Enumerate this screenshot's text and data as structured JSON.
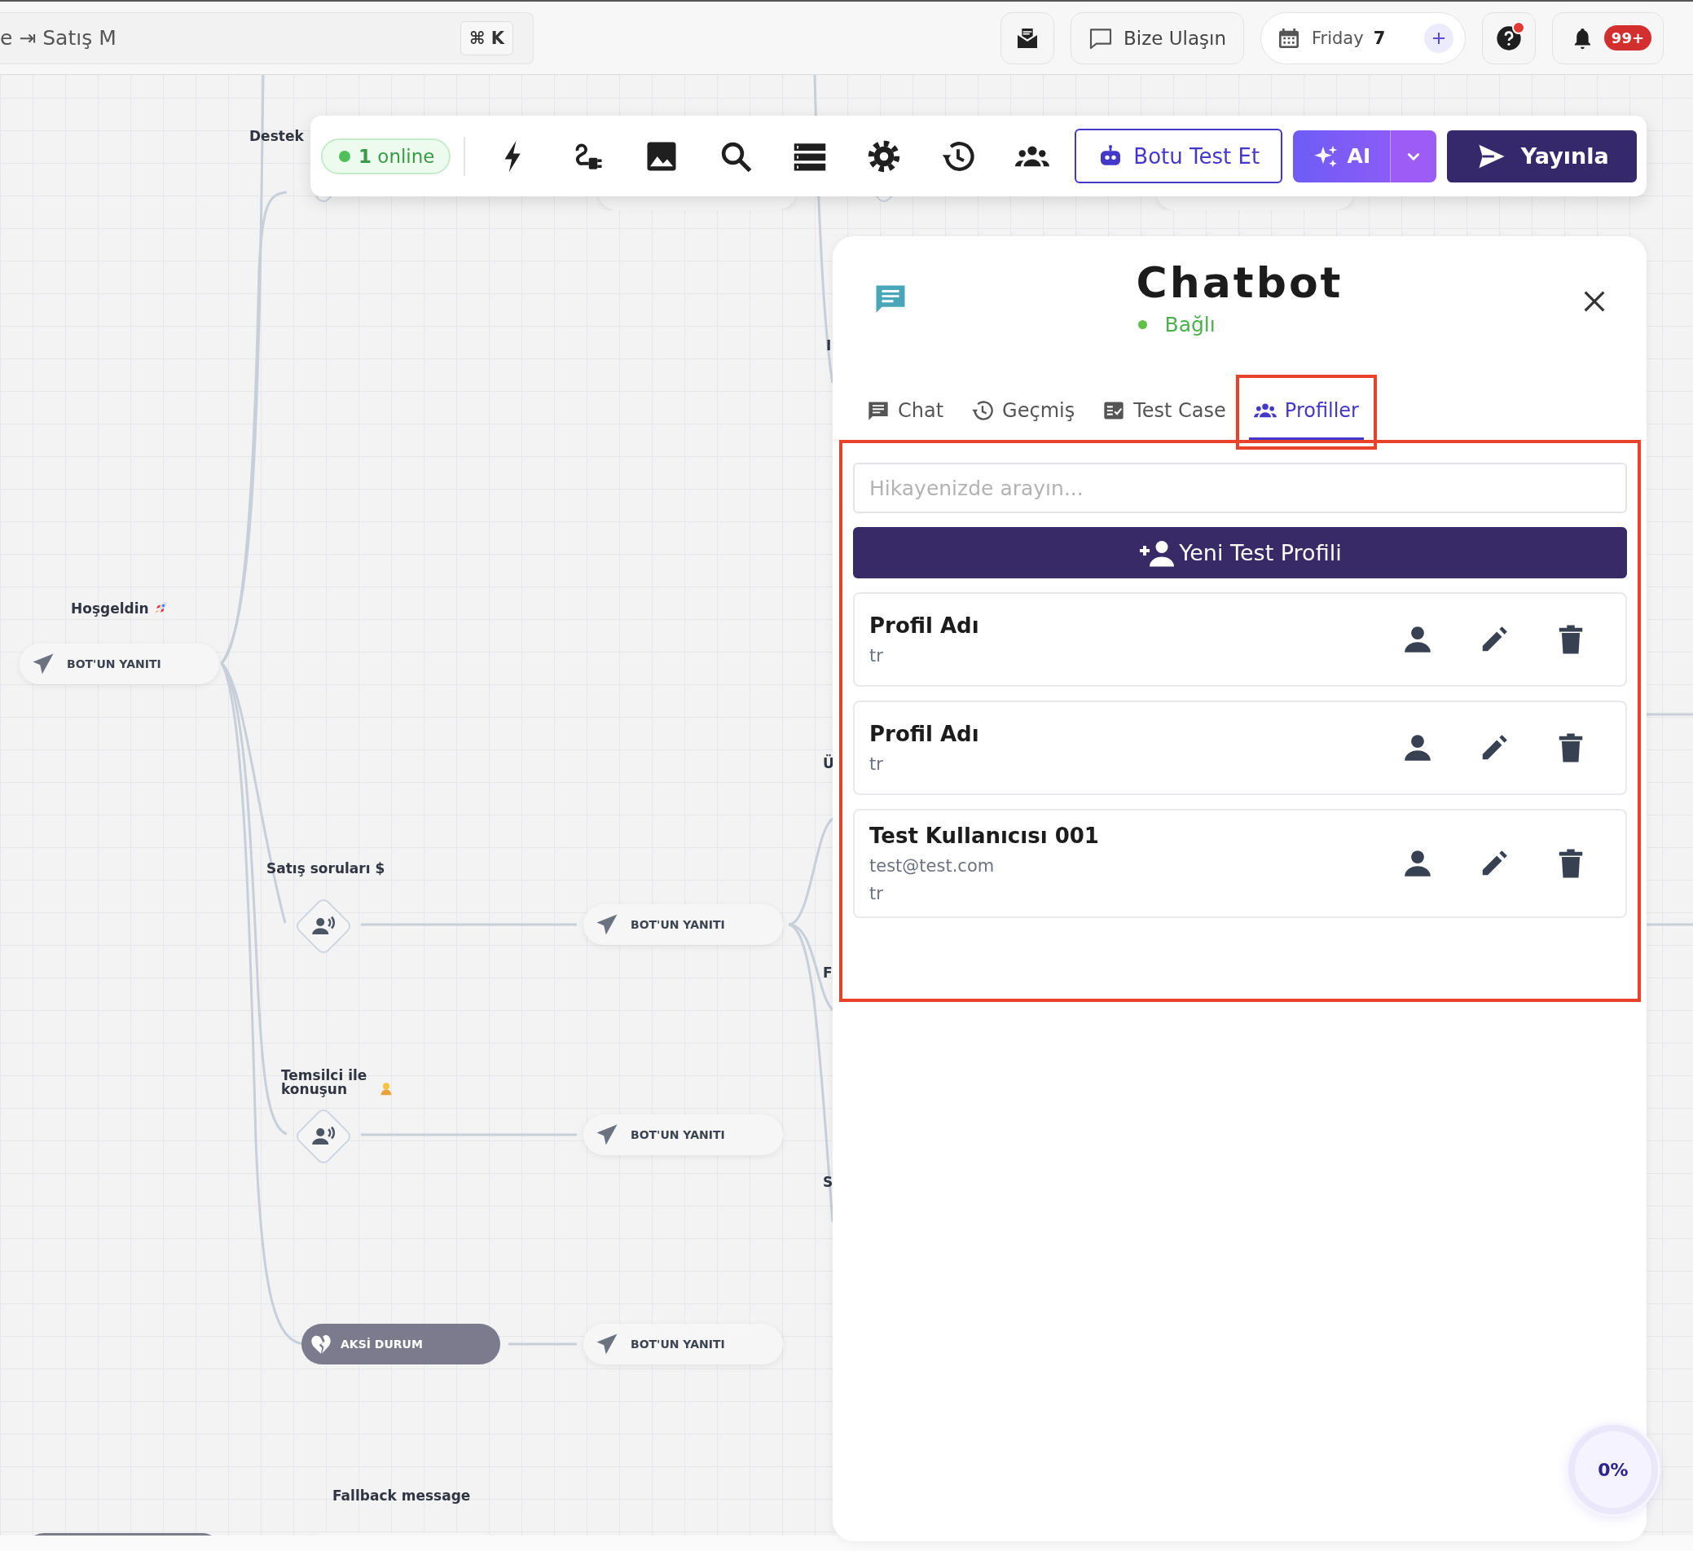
{
  "top_bar": {
    "breadcrumb": "e ⇥ Satış M",
    "shortcut": "⌘ K",
    "actions": [
      {
        "kind": "inbox"
      },
      {
        "kind": "contact",
        "label": "Bize Ulaşın"
      },
      {
        "kind": "date",
        "label": "Friday",
        "value": "7"
      },
      {
        "kind": "help",
        "alert": true
      },
      {
        "kind": "notifications",
        "badge": "99+"
      }
    ]
  },
  "toolbar": {
    "online": "**1** online",
    "tools": [
      {
        "kind": "bolt"
      },
      {
        "kind": "plug"
      },
      {
        "kind": "image"
      },
      {
        "kind": "search"
      },
      {
        "kind": "list"
      },
      {
        "kind": "settings"
      },
      {
        "kind": "history"
      },
      {
        "kind": "users"
      }
    ],
    "test_button": "Botu Test Et",
    "ai_button": "AI",
    "publish_button": "Yayınla"
  },
  "canvas": {
    "labels": [
      "Destek",
      "I",
      "Hoşgeldin",
      "Ü",
      "Satış soruları $",
      "F",
      "Temsilci ile konuşun",
      "S",
      "Fallback message"
    ],
    "nodes": [
      {
        "kind": "intent"
      },
      {
        "kind": "reply"
      },
      {
        "kind": "intent"
      },
      {
        "kind": "reply"
      },
      {
        "kind": "reply",
        "label": "BOT'UN YANITI"
      },
      {
        "kind": "intent"
      },
      {
        "kind": "reply",
        "label": "BOT'UN YANITI"
      },
      {
        "kind": "intent"
      },
      {
        "kind": "reply",
        "label": "BOT'UN YANITI"
      },
      {
        "kind": "fallback",
        "label": "AKSİ DURUM"
      },
      {
        "kind": "reply",
        "label": "BOT'UN YANITI"
      },
      {
        "kind": "fallback"
      },
      {
        "kind": "reply"
      }
    ]
  },
  "panel": {
    "title": "Chatbot",
    "status": "Bağlı",
    "connected": true,
    "tabs": [
      {
        "label": "Chat",
        "kind": "chat",
        "selected": false,
        "highlighted": false
      },
      {
        "label": "Geçmiş",
        "kind": "history",
        "selected": false,
        "highlighted": false
      },
      {
        "label": "Test Case",
        "kind": "checklist",
        "selected": false,
        "highlighted": false
      },
      {
        "label": "Profiller",
        "kind": "users",
        "selected": true,
        "highlighted": true
      }
    ],
    "content_highlighted": true,
    "search": {
      "placeholder": "Hikayenizde arayın..."
    },
    "new_profile_button": "Yeni Test Profili",
    "profiles": [
      {
        "name": "Profil Adı",
        "details": [
          "tr"
        ]
      },
      {
        "name": "Profil Adı",
        "details": [
          "tr"
        ]
      },
      {
        "name": "Test Kullanıcısı 001",
        "details": [
          "test@test.com",
          "tr"
        ]
      }
    ],
    "progress": "0%"
  }
}
